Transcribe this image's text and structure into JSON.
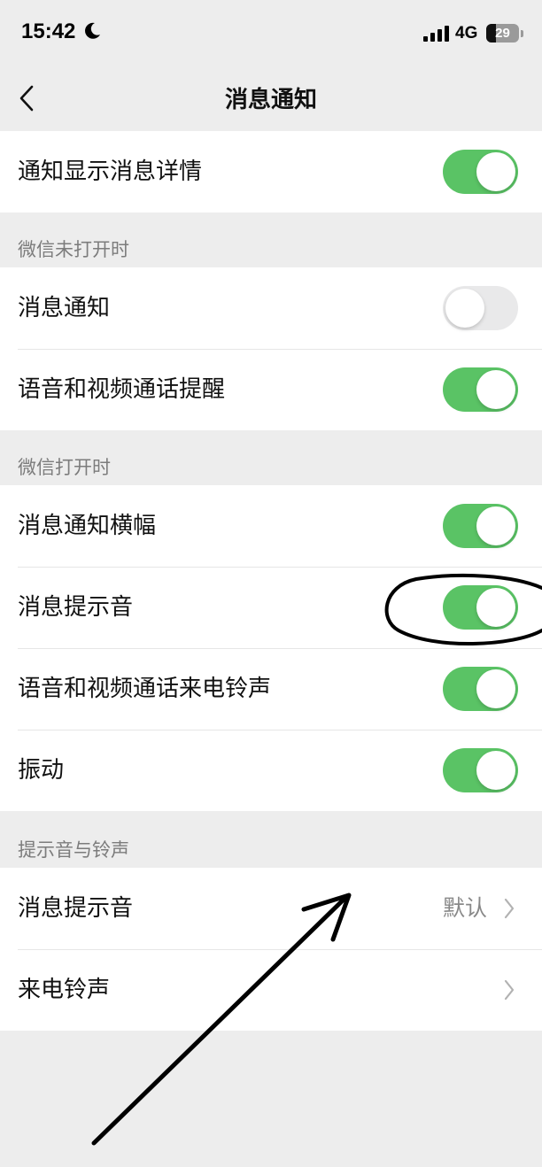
{
  "status_bar": {
    "time": "15:42",
    "network": "4G",
    "battery": "29",
    "battery_level": 0.29,
    "icons": [
      "moon-icon",
      "signal-icon",
      "battery-icon"
    ]
  },
  "nav": {
    "title": "消息通知",
    "back_icon": "chevron-left-icon"
  },
  "main": {
    "label": "通知显示消息详情",
    "toggle_on": true
  },
  "closed": {
    "header": "微信未打开时",
    "items": [
      {
        "label": "消息通知",
        "toggle_on": false
      },
      {
        "label": "语音和视频通话提醒",
        "toggle_on": true
      }
    ]
  },
  "open": {
    "header": "微信打开时",
    "items": [
      {
        "label": "消息通知横幅",
        "toggle_on": true
      },
      {
        "label": "消息提示音",
        "toggle_on": true
      },
      {
        "label": "语音和视频通话来电铃声",
        "toggle_on": true
      },
      {
        "label": "振动",
        "toggle_on": true
      }
    ]
  },
  "sounds": {
    "header": "提示音与铃声",
    "items": [
      {
        "label": "消息提示音",
        "value": "默认"
      },
      {
        "label": "来电铃声",
        "value": ""
      }
    ]
  },
  "colors": {
    "accent_green": "#5ac365",
    "toggle_off": "#e9e9ea",
    "background": "#ededed",
    "annotation": "#000000"
  },
  "annotations": [
    "hand-drawn-ellipse",
    "hand-drawn-arrow"
  ]
}
